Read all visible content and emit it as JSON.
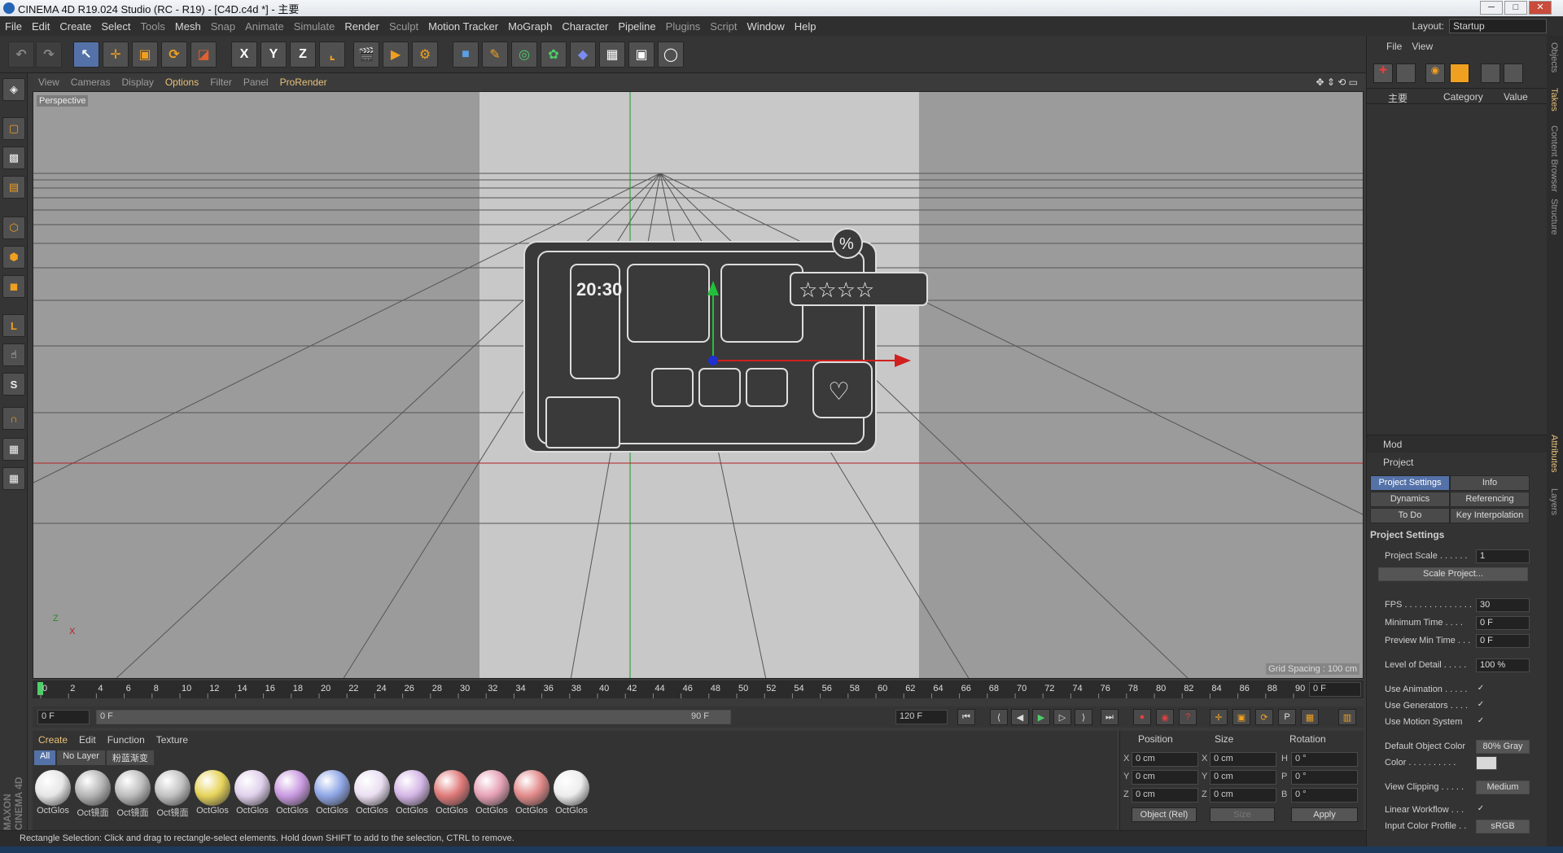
{
  "window": {
    "title": "CINEMA 4D R19.024 Studio (RC - R19) - [C4D.c4d *] - 主要",
    "layout_label": "Layout:",
    "layout_value": "Startup"
  },
  "menu": [
    "File",
    "Edit",
    "Create",
    "Select",
    "Tools",
    "Mesh",
    "Snap",
    "Animate",
    "Simulate",
    "Render",
    "Sculpt",
    "Motion Tracker",
    "MoGraph",
    "Character",
    "Pipeline",
    "Plugins",
    "Script",
    "Window",
    "Help"
  ],
  "toolbar": {
    "x_label": "X",
    "y_label": "Y",
    "z_label": "Z"
  },
  "viewport": {
    "menu": [
      "View",
      "Cameras",
      "Display",
      "Options",
      "Filter",
      "Panel",
      "ProRender"
    ],
    "camera_label": "Perspective",
    "grid_spacing": "Grid Spacing : 100 cm",
    "scene_clock": "20:30",
    "axis_z": "Z",
    "axis_x": "X"
  },
  "timeline": {
    "ticks": [
      "0",
      "2",
      "4",
      "6",
      "8",
      "10",
      "12",
      "14",
      "16",
      "18",
      "20",
      "22",
      "24",
      "26",
      "28",
      "30",
      "32",
      "34",
      "36",
      "38",
      "40",
      "42",
      "44",
      "46",
      "48",
      "50",
      "52",
      "54",
      "56",
      "58",
      "60",
      "62",
      "64",
      "66",
      "68",
      "70",
      "72",
      "74",
      "76",
      "78",
      "80",
      "82",
      "84",
      "86",
      "88",
      "90"
    ],
    "current_frame": "0 F",
    "start_field": "0 F",
    "range_start": "0 F",
    "range_end": "90 F",
    "end_field": "120 F"
  },
  "materials": {
    "menu": [
      "Create",
      "Edit",
      "Function",
      "Texture"
    ],
    "tabs": [
      "All",
      "No Layer",
      "粉蓝渐变"
    ],
    "items": [
      {
        "name": "OctGlos",
        "color": "#e6e6e6"
      },
      {
        "name": "Oct镜面",
        "color": "#b5b5b5"
      },
      {
        "name": "Oct镜面",
        "color": "#bdbdbd"
      },
      {
        "name": "Oct镜面",
        "color": "#c2c2c2"
      },
      {
        "name": "OctGlos",
        "color": "#e6d35a"
      },
      {
        "name": "OctGlos",
        "color": "#e0d0ec"
      },
      {
        "name": "OctGlos",
        "color": "#c99ae0"
      },
      {
        "name": "OctGlos",
        "color": "#8fa6e6"
      },
      {
        "name": "OctGlos",
        "color": "#eadff2"
      },
      {
        "name": "OctGlos",
        "color": "#d4b6e6"
      },
      {
        "name": "OctGlos",
        "color": "#e07a7a"
      },
      {
        "name": "OctGlos",
        "color": "#e6a1b6"
      },
      {
        "name": "OctGlos",
        "color": "#e28a8a"
      },
      {
        "name": "OctGlos",
        "color": "#ededed"
      }
    ]
  },
  "coordinates": {
    "headers": [
      "Position",
      "Size",
      "Rotation"
    ],
    "rows": [
      {
        "pl": "X",
        "p": "0 cm",
        "sl": "X",
        "s": "0 cm",
        "rl": "H",
        "r": "0 °"
      },
      {
        "pl": "Y",
        "p": "0 cm",
        "sl": "Y",
        "s": "0 cm",
        "rl": "P",
        "r": "0 °"
      },
      {
        "pl": "Z",
        "p": "0 cm",
        "sl": "Z",
        "s": "0 cm",
        "rl": "B",
        "r": "0 °"
      }
    ],
    "mode": "Object (Rel)",
    "size_mode": "Size",
    "apply": "Apply"
  },
  "status": "Rectangle Selection: Click and drag to rectangle-select elements. Hold down SHIFT to add to the selection, CTRL to remove.",
  "objects": {
    "menu": [
      "File",
      "View"
    ],
    "take_name": "主要",
    "col_category": "Category",
    "col_value": "Value"
  },
  "attributes": {
    "menu": "Mod",
    "object": "Project",
    "tabs": [
      "Project Settings",
      "Info",
      "Dynamics",
      "Referencing",
      "To Do",
      "Key Interpolation"
    ],
    "section": "Project Settings",
    "rows": [
      {
        "label": "Project Scale . . . . . .",
        "value": "1"
      },
      {
        "label": "",
        "value": "Scale Project..."
      },
      {
        "label": "FPS . . . . . . . . . . . . . .",
        "value": "30"
      },
      {
        "label": "Minimum Time . . . .",
        "value": "0 F"
      },
      {
        "label": "Preview Min Time . . .",
        "value": "0 F"
      },
      {
        "label": "Level of Detail . . . . .",
        "value": "100 %"
      },
      {
        "label": "Use Animation . . . . .",
        "value": "✓"
      },
      {
        "label": "Use Generators . . . .",
        "value": "✓"
      },
      {
        "label": "Use Motion System",
        "value": "✓"
      },
      {
        "label": "Default Object Color",
        "value": "80% Gray"
      },
      {
        "label": "Color . . . . . . . . . .",
        "value": ""
      },
      {
        "label": "View Clipping . . . . .",
        "value": "Medium"
      },
      {
        "label": "Linear Workflow . . .",
        "value": "✓"
      },
      {
        "label": "Input Color Profile . .",
        "value": "sRGB"
      }
    ]
  },
  "side_tabs": [
    "Objects",
    "Takes",
    "Content Browser",
    "Structure",
    "Attributes",
    "Layers"
  ],
  "brand": "MAXON CINEMA 4D",
  "colors": {
    "accent": "#5472a8",
    "highlight": "#e8c27a"
  }
}
